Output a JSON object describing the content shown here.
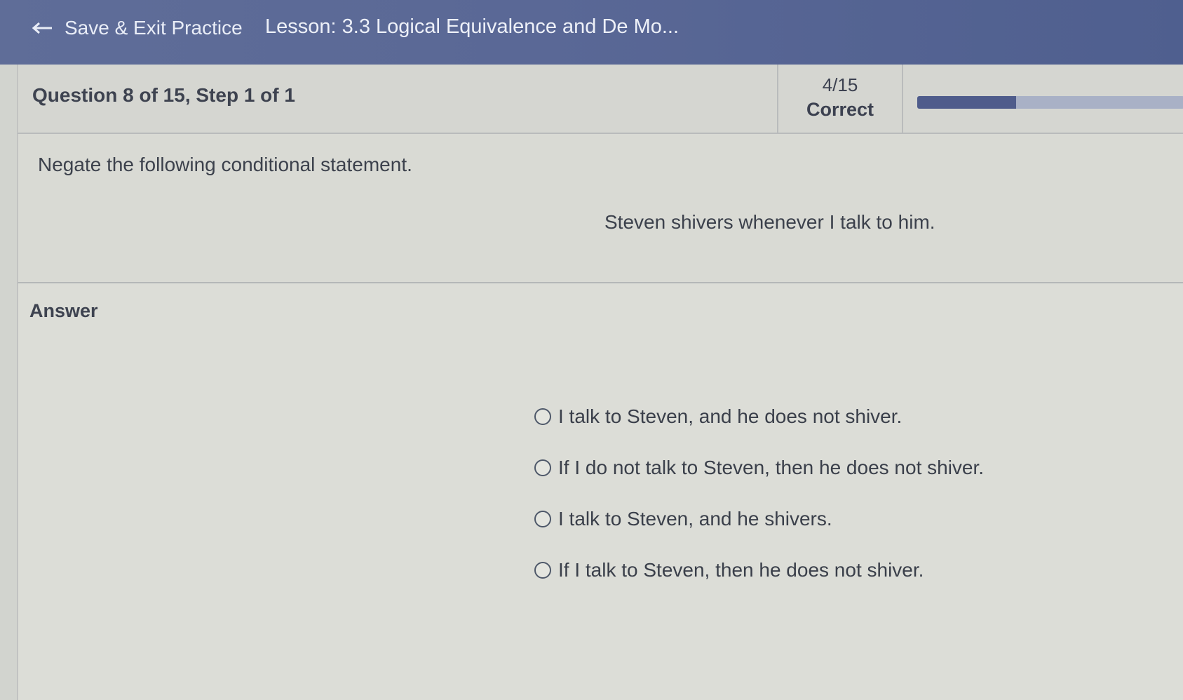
{
  "header": {
    "back_label": "Save & Exit Practice",
    "lesson_title": "Lesson: 3.3 Logical Equivalence and De Mo..."
  },
  "status": {
    "question_label": "Question 8 of 15,  Step 1 of 1",
    "score": "4/15",
    "score_label": "Correct",
    "progress_fraction": 0.37
  },
  "question": {
    "prompt": "Negate the following conditional statement.",
    "statement": "Steven shivers whenever I talk to him."
  },
  "answer": {
    "label": "Answer",
    "options": [
      {
        "text": "I talk to Steven, and he does not shiver."
      },
      {
        "text": "If I do not talk to Steven, then he does not shiver."
      },
      {
        "text": "I talk to Steven, and he shivers."
      },
      {
        "text": "If I talk to Steven, then he does not shiver."
      }
    ]
  },
  "colors": {
    "topbar": "#5a6896",
    "progress_fill": "#4f5c8b",
    "progress_track": "#a9b1c6"
  }
}
